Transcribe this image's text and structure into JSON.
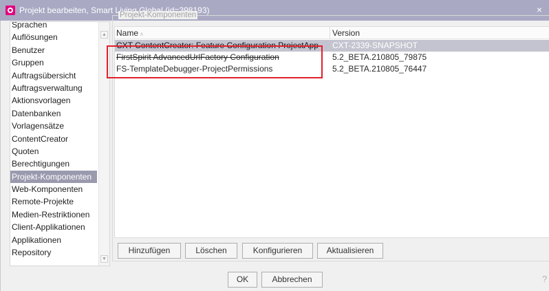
{
  "window": {
    "title": "Projekt bearbeiten, Smart Living Global (id=398193)",
    "close_label": "×"
  },
  "nav": {
    "items": [
      {
        "label": "Sprachen"
      },
      {
        "label": "Auflösungen"
      },
      {
        "label": "Benutzer"
      },
      {
        "label": "Gruppen"
      },
      {
        "label": "Auftragsübersicht"
      },
      {
        "label": "Auftragsverwaltung"
      },
      {
        "label": "Aktionsvorlagen"
      },
      {
        "label": "Datenbanken"
      },
      {
        "label": "Vorlagensätze"
      },
      {
        "label": "ContentCreator"
      },
      {
        "label": "Quoten"
      },
      {
        "label": "Berechtigungen"
      },
      {
        "label": "Projekt-Komponenten",
        "selected": true
      },
      {
        "label": "Web-Komponenten"
      },
      {
        "label": "Remote-Projekte"
      },
      {
        "label": "Medien-Restriktionen"
      },
      {
        "label": "Client-Applikationen"
      },
      {
        "label": "Applikationen"
      },
      {
        "label": "Repository"
      }
    ]
  },
  "panel": {
    "title": "Projekt-Komponenten",
    "table": {
      "columns": [
        "Name",
        "Version"
      ],
      "rows": [
        {
          "name": "CXT ContentCreator: Feature Configuration ProjectApp",
          "version": "CXT-2339-SNAPSHOT",
          "selected": true
        },
        {
          "name": "FirstSpirit AdvancedUrlFactory Configuration",
          "version": "5.2_BETA.210805_79875"
        },
        {
          "name": "FS-TemplateDebugger-ProjectPermissions",
          "version": "5.2_BETA.210805_76447"
        }
      ]
    },
    "buttons": {
      "add": "Hinzufügen",
      "delete": "Löschen",
      "configure": "Konfigurieren",
      "refresh": "Aktualisieren"
    }
  },
  "footer": {
    "ok": "OK",
    "cancel": "Abbrechen"
  },
  "colors": {
    "titlebar": "#a9a9c4",
    "selection": "#9a9aaf",
    "highlight_border": "#e0202a",
    "app_icon": "#e4007f"
  }
}
